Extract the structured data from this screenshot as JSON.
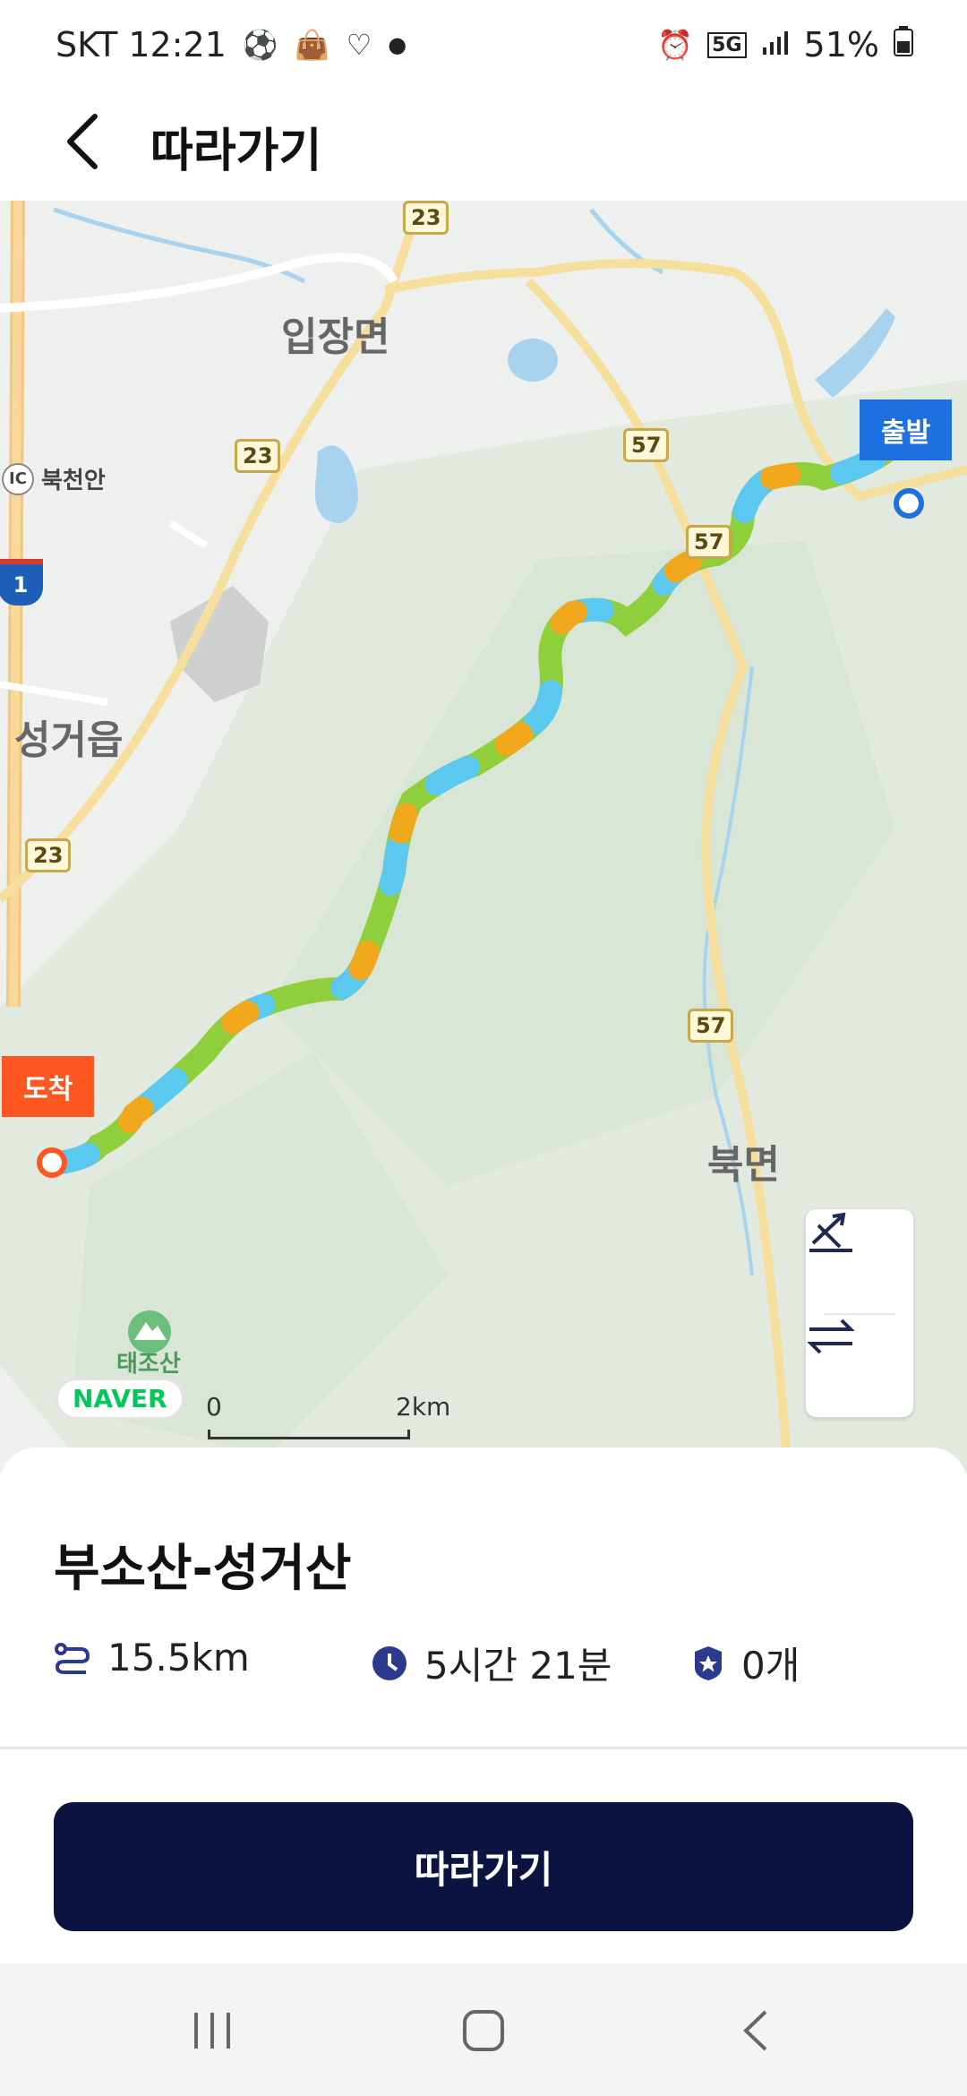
{
  "status_bar": {
    "carrier_time": "SKT 12:21",
    "network": "5G",
    "battery": "51%"
  },
  "header": {
    "title": "따라가기"
  },
  "map": {
    "labels": {
      "ipjang": "입장면",
      "bukcheonan": "북천안",
      "ic": "IC",
      "seonggeo": "성거읍",
      "bukmyeon": "북면",
      "taejosan": "태조산"
    },
    "road_badges": {
      "r23_top": "23",
      "r23_mid": "23",
      "r23_low": "23",
      "r57_a": "57",
      "r57_b": "57",
      "r57_c": "57",
      "hw1": "1"
    },
    "start_label": "출발",
    "end_label": "도착",
    "logo": "NAVER",
    "scale_start": "0",
    "scale_end": "2km"
  },
  "route": {
    "name": "부소산-성거산",
    "distance": "15.5km",
    "duration": "5시간 21분",
    "badges": "0개"
  },
  "actions": {
    "follow_label": "따라가기"
  },
  "colors": {
    "primary": "#0b1340",
    "start_flag": "#1e6fe0",
    "end_flag": "#ff5722"
  }
}
